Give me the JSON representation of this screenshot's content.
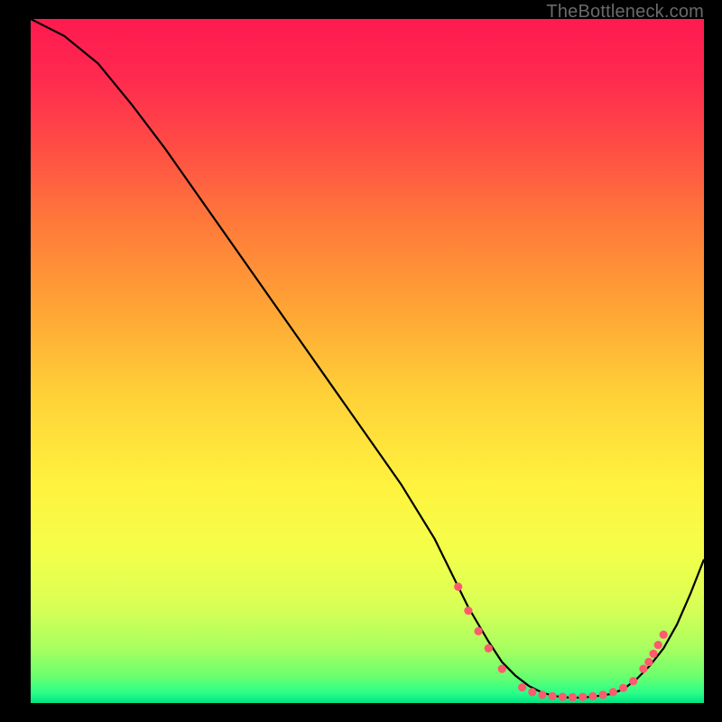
{
  "watermark": "TheBottleneck.com",
  "chart_data": {
    "type": "line",
    "title": "",
    "xlabel": "",
    "ylabel": "",
    "xlim": [
      0,
      100
    ],
    "ylim": [
      0,
      100
    ],
    "grid": false,
    "series": [
      {
        "name": "curve",
        "x": [
          0,
          2,
          5,
          10,
          15,
          20,
          25,
          30,
          35,
          40,
          45,
          50,
          55,
          60,
          63,
          65,
          68,
          70,
          72,
          74,
          76,
          78,
          80,
          82,
          84,
          86,
          88,
          90,
          92,
          94,
          96,
          98,
          100
        ],
        "y": [
          100,
          99,
          97.5,
          93.5,
          87.5,
          81,
          74,
          67,
          60,
          53,
          46,
          39,
          32,
          24,
          18,
          14,
          9,
          6,
          4,
          2.5,
          1.5,
          1,
          0.8,
          0.8,
          1,
          1.3,
          2,
          3.5,
          5.5,
          8,
          11.5,
          16,
          21
        ]
      }
    ],
    "markers": [
      {
        "x": 63.5,
        "y": 17
      },
      {
        "x": 65,
        "y": 13.5
      },
      {
        "x": 66.5,
        "y": 10.5
      },
      {
        "x": 68,
        "y": 8
      },
      {
        "x": 70,
        "y": 5
      },
      {
        "x": 73,
        "y": 2.3
      },
      {
        "x": 74.5,
        "y": 1.6
      },
      {
        "x": 76,
        "y": 1.2
      },
      {
        "x": 77.5,
        "y": 1.0
      },
      {
        "x": 79,
        "y": 0.9
      },
      {
        "x": 80.5,
        "y": 0.85
      },
      {
        "x": 82,
        "y": 0.9
      },
      {
        "x": 83.5,
        "y": 1.0
      },
      {
        "x": 85,
        "y": 1.2
      },
      {
        "x": 86.5,
        "y": 1.6
      },
      {
        "x": 88,
        "y": 2.2
      },
      {
        "x": 89.5,
        "y": 3.2
      },
      {
        "x": 91,
        "y": 5
      },
      {
        "x": 91.8,
        "y": 6
      },
      {
        "x": 92.5,
        "y": 7.2
      },
      {
        "x": 93.2,
        "y": 8.5
      },
      {
        "x": 94,
        "y": 10
      }
    ],
    "gradient_stops": [
      {
        "pos": 0.0,
        "color": "#ff1a4f"
      },
      {
        "pos": 0.08,
        "color": "#ff2850"
      },
      {
        "pos": 0.18,
        "color": "#ff4a45"
      },
      {
        "pos": 0.3,
        "color": "#ff7a3a"
      },
      {
        "pos": 0.42,
        "color": "#ffa335"
      },
      {
        "pos": 0.55,
        "color": "#ffd138"
      },
      {
        "pos": 0.68,
        "color": "#fff23e"
      },
      {
        "pos": 0.78,
        "color": "#f3ff4a"
      },
      {
        "pos": 0.86,
        "color": "#d8ff55"
      },
      {
        "pos": 0.92,
        "color": "#a8ff60"
      },
      {
        "pos": 0.96,
        "color": "#6dff6e"
      },
      {
        "pos": 0.985,
        "color": "#2bff88"
      },
      {
        "pos": 1.0,
        "color": "#00e083"
      }
    ]
  }
}
